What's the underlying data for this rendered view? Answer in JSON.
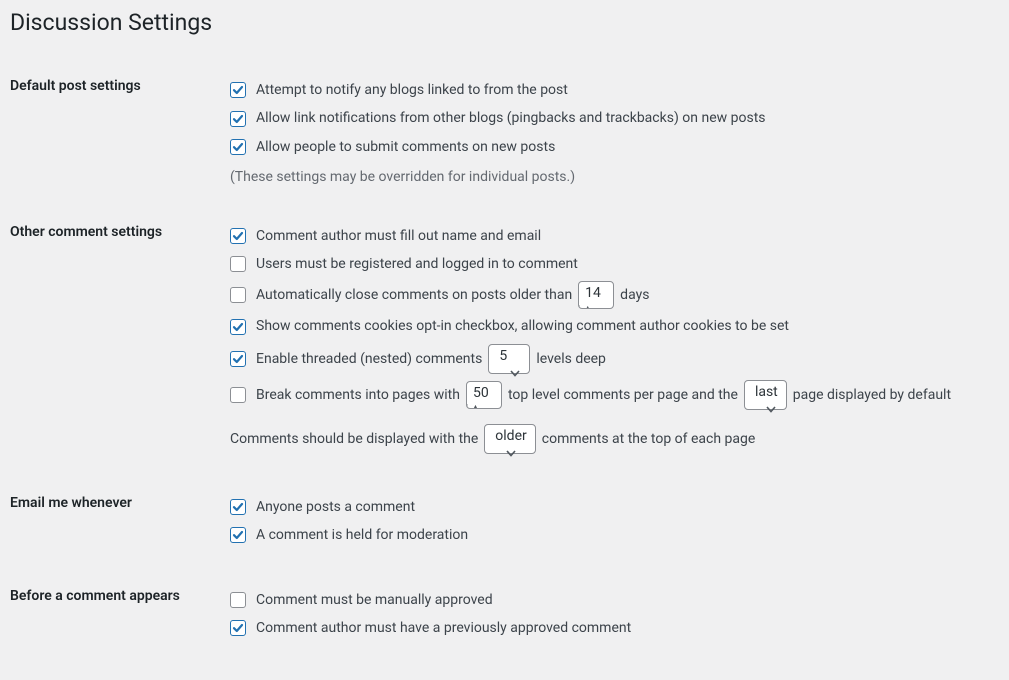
{
  "page": {
    "title": "Discussion Settings"
  },
  "default_post": {
    "heading": "Default post settings",
    "notify": {
      "label": "Attempt to notify any blogs linked to from the post",
      "checked": true
    },
    "allow_pingbacks": {
      "label": "Allow link notifications from other blogs (pingbacks and trackbacks) on new posts",
      "checked": true
    },
    "allow_comments": {
      "label": "Allow people to submit comments on new posts",
      "checked": true
    },
    "note": "(These settings may be overridden for individual posts.)"
  },
  "other_comment": {
    "heading": "Other comment settings",
    "require_name_email": {
      "label": "Comment author must fill out name and email",
      "checked": true
    },
    "require_registered": {
      "label": "Users must be registered and logged in to comment",
      "checked": false
    },
    "auto_close": {
      "prefix": "Automatically close comments on posts older than",
      "value": "14",
      "suffix": "days",
      "checked": false
    },
    "cookies_opt_in": {
      "label": "Show comments cookies opt-in checkbox, allowing comment author cookies to be set",
      "checked": true
    },
    "threaded": {
      "prefix": "Enable threaded (nested) comments",
      "value": "5",
      "suffix": "levels deep",
      "checked": true
    },
    "paginate": {
      "prefix": "Break comments into pages with",
      "value": "50",
      "mid1": "top level comments per page and the",
      "page_default": "last",
      "suffix": "page displayed by default",
      "checked": false
    },
    "order": {
      "prefix": "Comments should be displayed with the",
      "value": "older",
      "suffix": "comments at the top of each page"
    }
  },
  "email_me": {
    "heading": "Email me whenever",
    "anyone_posts": {
      "label": "Anyone posts a comment",
      "checked": true
    },
    "held_moderation": {
      "label": "A comment is held for moderation",
      "checked": true
    }
  },
  "before_appears": {
    "heading": "Before a comment appears",
    "manually_approved": {
      "label": "Comment must be manually approved",
      "checked": false
    },
    "prev_approved": {
      "label": "Comment author must have a previously approved comment",
      "checked": true
    }
  }
}
